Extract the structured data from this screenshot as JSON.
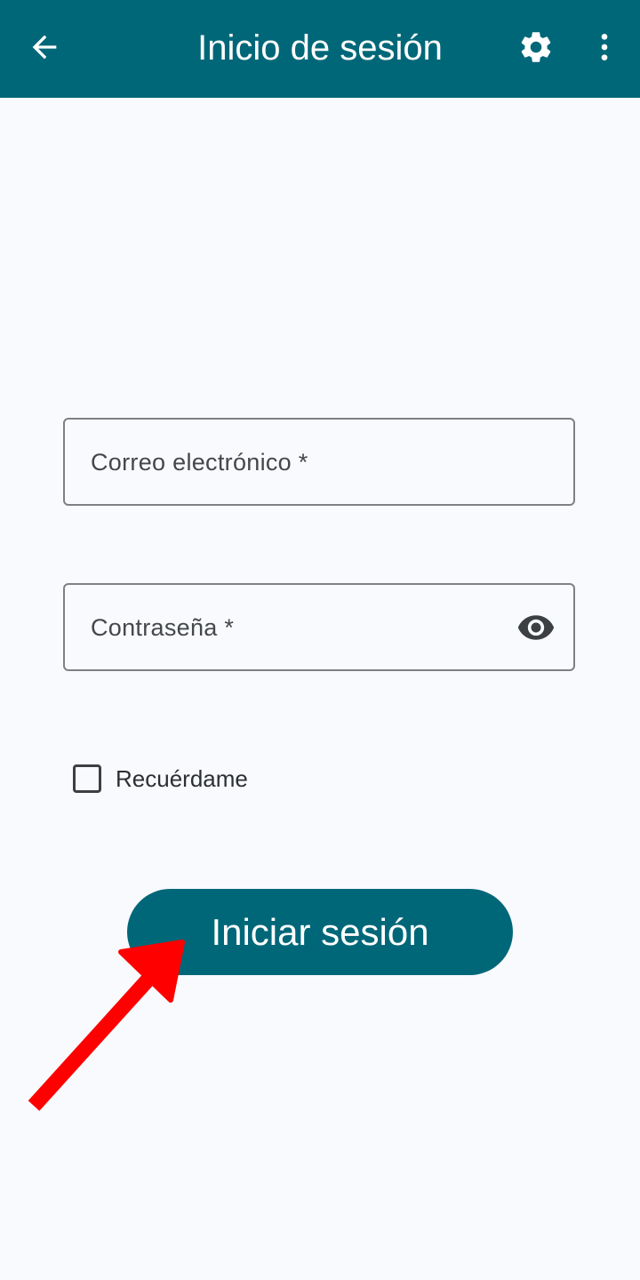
{
  "app_bar": {
    "title": "Inicio de sesión",
    "back_icon": "arrow-back-icon",
    "settings_icon": "gear-icon",
    "more_icon": "more-vert-icon",
    "background_color": "#006779"
  },
  "form": {
    "email_label": "Correo electrónico *",
    "password_label": "Contraseña *",
    "password_toggle_icon": "eye-icon",
    "remember_label": "Recuérdame",
    "remember_checked": false,
    "submit_label": "Iniciar sesión"
  },
  "annotation": {
    "icon": "red-arrow-icon",
    "color": "#ff0000"
  }
}
